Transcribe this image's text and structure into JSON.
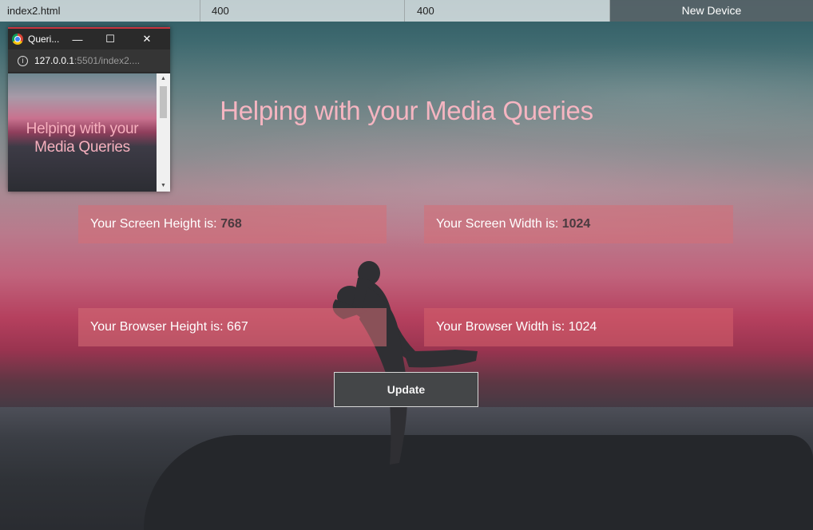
{
  "topbar": {
    "filename": "index2.html",
    "width_value": "400",
    "height_value": "400",
    "new_device_label": "New Device"
  },
  "mini_window": {
    "title": "Queri...",
    "minimize_glyph": "—",
    "maximize_glyph": "☐",
    "close_glyph": "✕",
    "url_host": "127.0.0.1",
    "url_rest": ":5501/index2....",
    "heading": "Helping with your Media Queries",
    "icons": [
      "chrome-icon",
      "info-icon"
    ]
  },
  "main": {
    "heading": "Helping with your Media Queries",
    "screen_height_label": "Your Screen Height is: ",
    "screen_height_value": "768",
    "screen_width_label": "Your Screen Width is: ",
    "screen_width_value": "1024",
    "browser_height_label": "Your Browser Height is: ",
    "browser_height_value": "667",
    "browser_width_label": "Your Browser Width is: ",
    "browser_width_value": "1024",
    "update_label": "Update"
  },
  "colors": {
    "heading_pink": "#f5b5c1",
    "card_bg": "#d66e76",
    "accent_red": "#c5343e"
  }
}
